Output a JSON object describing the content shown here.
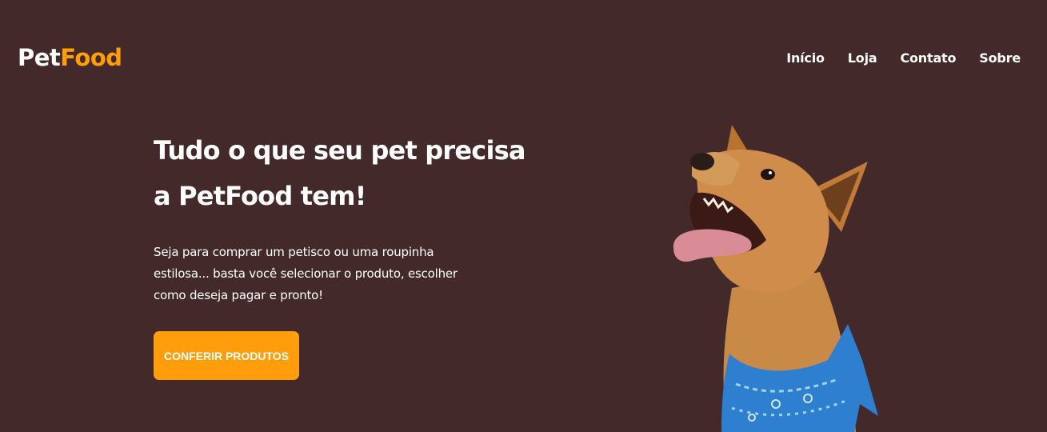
{
  "header": {
    "logo": {
      "part1": "Pet",
      "part2": "Food"
    },
    "nav": [
      {
        "label": "Início"
      },
      {
        "label": "Loja"
      },
      {
        "label": "Contato"
      },
      {
        "label": "Sobre"
      }
    ]
  },
  "hero": {
    "title_line1": "Tudo o que seu pet precisa",
    "title_line2": "a PetFood tem!",
    "description": "Seja para comprar um petisco ou uma roupinha estilosa... basta você selecionar o produto, escolher como deseja pagar e pronto!",
    "cta_label": "CONFERIR PRODUTOS"
  },
  "colors": {
    "background": "#43292a",
    "accent": "#ff9d0a",
    "text": "#ffffff",
    "bandana": "#2f7fd0"
  },
  "image": {
    "icon": "dog-with-blue-bandana"
  }
}
